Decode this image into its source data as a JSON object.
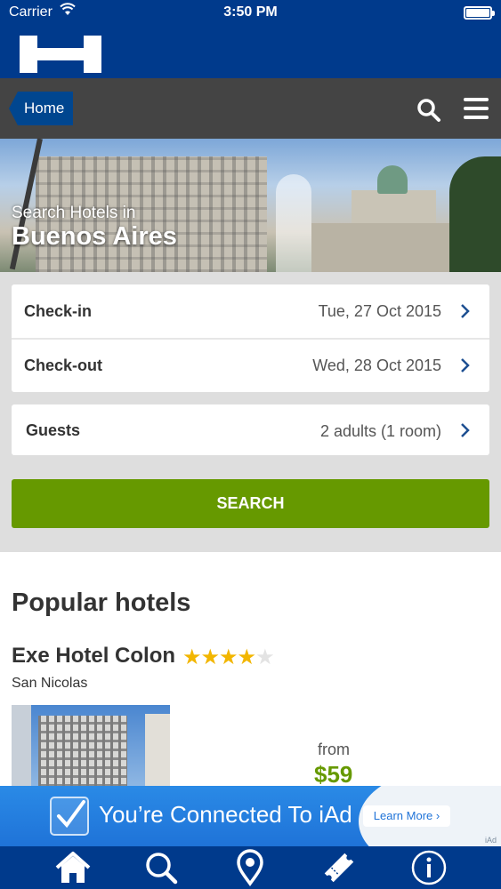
{
  "status_bar": {
    "carrier": "Carrier",
    "time": "3:50 PM"
  },
  "colors": {
    "brand_blue": "#003a8c",
    "nav_dark": "#444444",
    "accent_green": "#669900",
    "star_gold": "#f2b600"
  },
  "nav": {
    "home_label": "Home",
    "icons": [
      "search-icon",
      "menu-icon"
    ]
  },
  "hero": {
    "subtitle": "Search Hotels in",
    "city": "Buenos Aires"
  },
  "form": {
    "checkin": {
      "label": "Check-in",
      "value": "Tue, 27 Oct 2015"
    },
    "checkout": {
      "label": "Check-out",
      "value": "Wed, 28 Oct 2015"
    },
    "guests": {
      "label": "Guests",
      "value": "2 adults (1 room)"
    },
    "search_label": "SEARCH"
  },
  "popular": {
    "title": "Popular hotels",
    "hotels": [
      {
        "name": "Exe Hotel Colon",
        "stars": 4,
        "max_stars": 5,
        "area": "San Nicolas",
        "from_label": "from",
        "price": "$59"
      }
    ]
  },
  "ad": {
    "text": "You’re Connected To iAd",
    "button": "Learn More ›",
    "tag": "iAd"
  },
  "tabbar": {
    "icons": [
      "home-icon",
      "search-icon",
      "location-pin-icon",
      "ticket-icon",
      "info-icon"
    ]
  }
}
